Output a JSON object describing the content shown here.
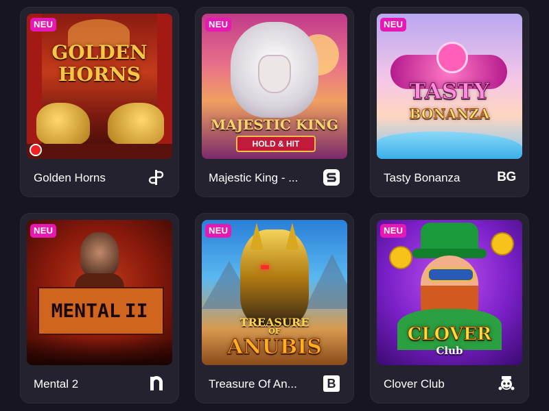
{
  "badge_label": "NEU",
  "games": [
    {
      "title": "Golden Horns",
      "art_line1": "GOLDEN",
      "art_line2": "HORNS",
      "provider_icon": "ps-bar-icon"
    },
    {
      "title": "Majestic King - ...",
      "art_line1": "MAJESTIC KING",
      "art_line2": "HOLD & HIT",
      "provider_icon": "s-rounded-icon"
    },
    {
      "title": "Tasty Bonanza",
      "art_line1": "TASTY",
      "art_line2": "BONANZA",
      "provider_text": "BG"
    },
    {
      "title": "Mental 2",
      "art_line1": "MENTAL",
      "art_line2": "II",
      "provider_icon": "n-arch-icon"
    },
    {
      "title": "Treasure Of An...",
      "art_line1": "TREASURE",
      "art_line2": "OF",
      "art_line3": "ANUBIS",
      "provider_text": "B"
    },
    {
      "title": "Clover Club",
      "art_line1": "CLOVER",
      "art_line2": "Club",
      "provider_icon": "mascot-icon"
    }
  ],
  "colors": {
    "background": "#17151f",
    "card": "#25222f",
    "badge": "#e619b4"
  }
}
